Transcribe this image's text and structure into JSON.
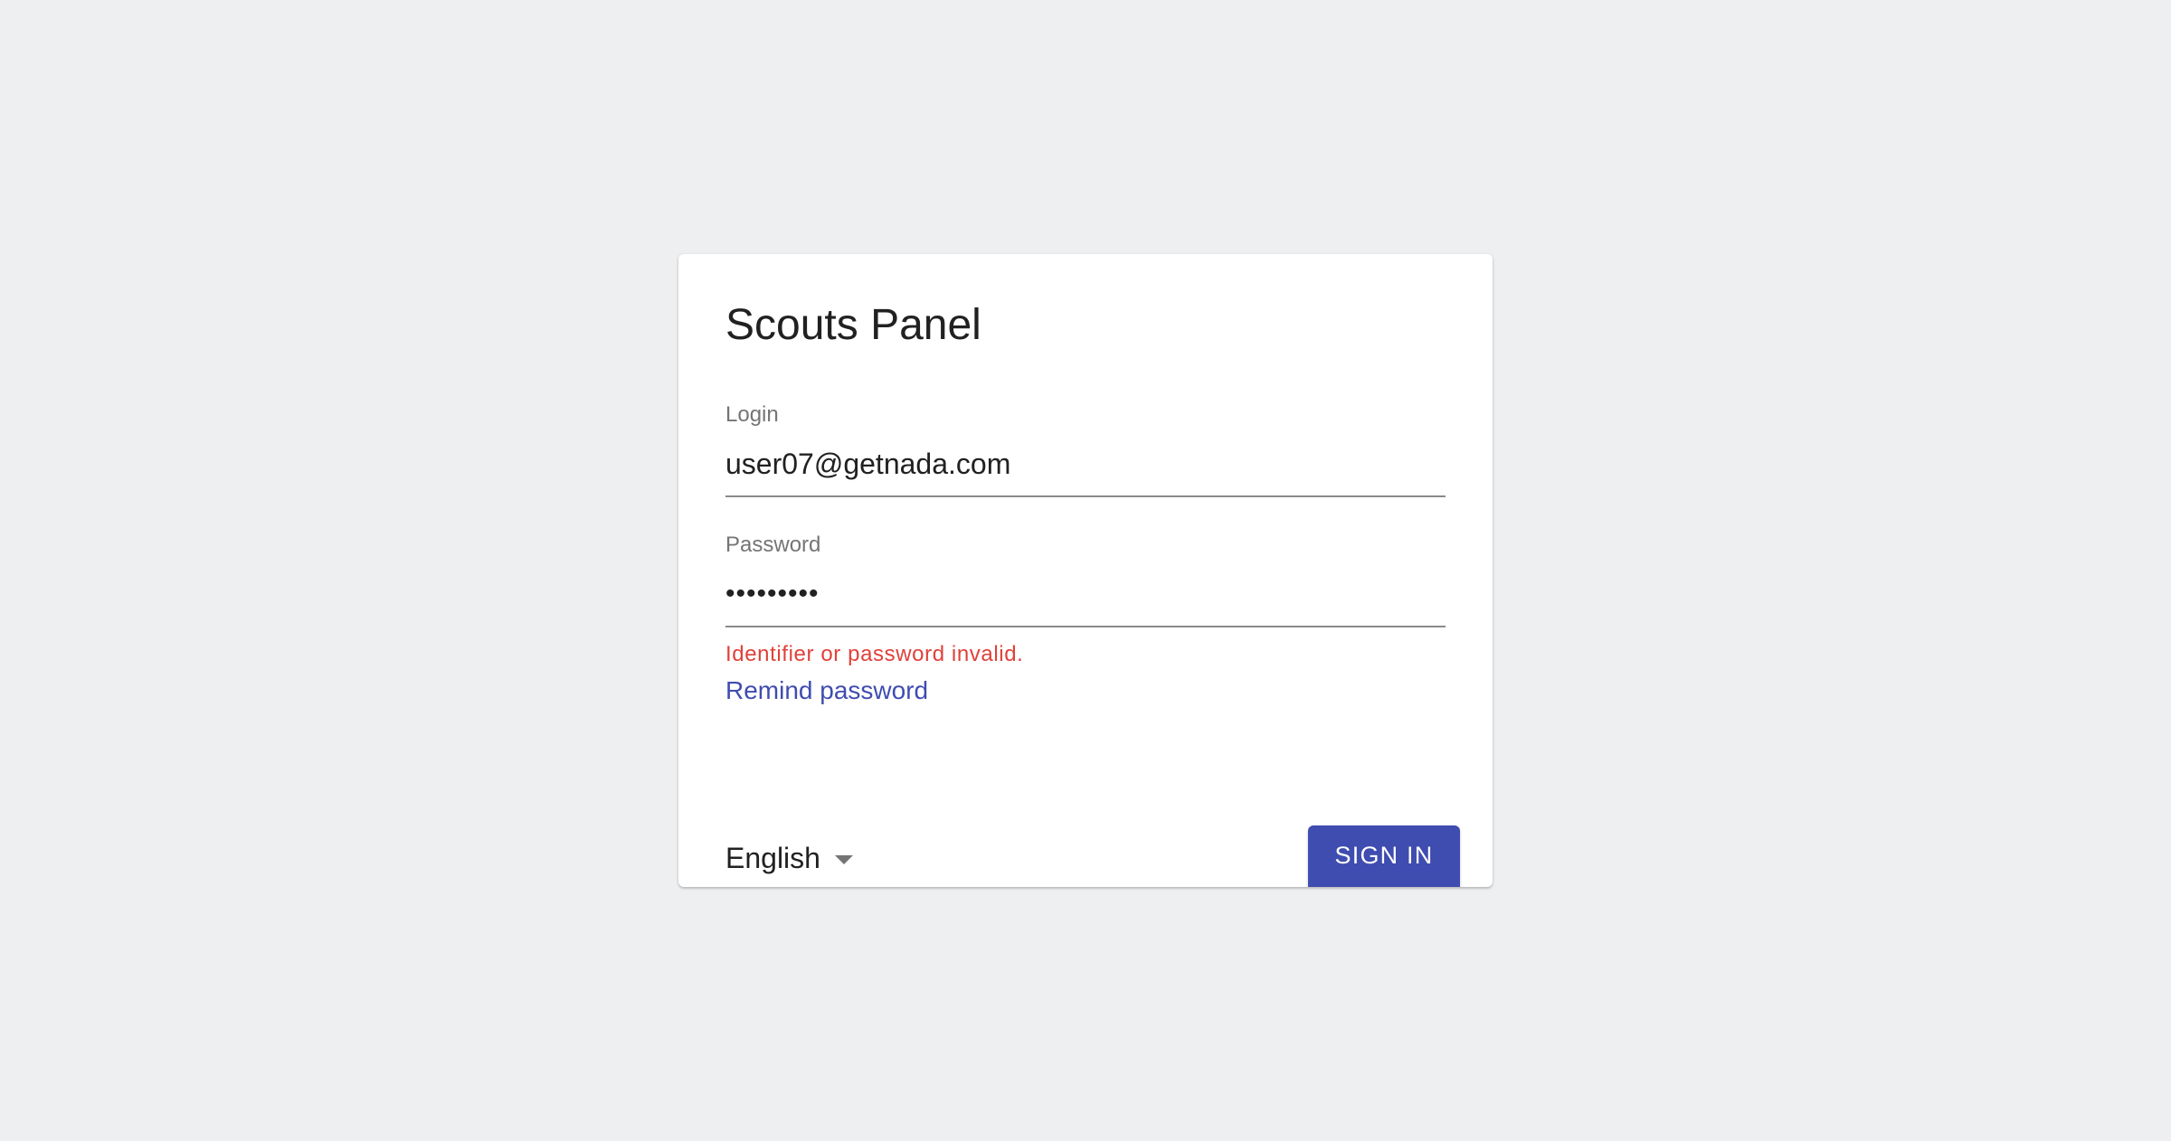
{
  "app": {
    "title": "Scouts Panel"
  },
  "form": {
    "login": {
      "label": "Login",
      "value": "user07@getnada.com",
      "placeholder": ""
    },
    "password": {
      "label": "Password",
      "value": "•••••••••",
      "placeholder": ""
    },
    "error": "Identifier or password invalid.",
    "remind_link": "Remind password",
    "language": {
      "selected": "English",
      "icon": "caret-down-icon"
    },
    "submit_label": "SIGN IN"
  },
  "colors": {
    "background": "#eeeff1",
    "accent": "#3f4cb0",
    "error": "#e0413a"
  }
}
